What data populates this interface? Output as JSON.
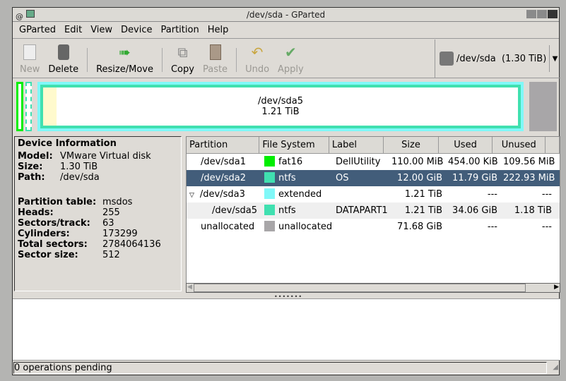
{
  "window": {
    "title": "/dev/sda - GParted"
  },
  "menu": [
    "GParted",
    "Edit",
    "View",
    "Device",
    "Partition",
    "Help"
  ],
  "toolbar": {
    "new": "New",
    "delete": "Delete",
    "resize_move": "Resize/Move",
    "copy": "Copy",
    "paste": "Paste",
    "undo": "Undo",
    "apply": "Apply"
  },
  "device_selector": {
    "device": "/dev/sda",
    "size": "(1.30 TiB)"
  },
  "disk_map": {
    "selected_partition": "/dev/sda5",
    "selected_size": "1.21 TiB",
    "colors": {
      "fat16": "#00ee00",
      "ntfs": "#40e0b0",
      "extended": "#80f8f8",
      "unallocated": "#a8a6a8"
    }
  },
  "device_info": {
    "title": "Device Information",
    "model_label": "Model:",
    "model": "VMware Virtual disk",
    "size_label": "Size:",
    "size": "1.30 TiB",
    "path_label": "Path:",
    "path": "/dev/sda",
    "partition_table_label": "Partition table:",
    "partition_table": "msdos",
    "heads_label": "Heads:",
    "heads": "255",
    "sectors_track_label": "Sectors/track:",
    "sectors_track": "63",
    "cylinders_label": "Cylinders:",
    "cylinders": "173299",
    "total_sectors_label": "Total sectors:",
    "total_sectors": "2784064136",
    "sector_size_label": "Sector size:",
    "sector_size": "512"
  },
  "table": {
    "headers": [
      "Partition",
      "File System",
      "Label",
      "Size",
      "Used",
      "Unused"
    ],
    "rows": [
      {
        "partition": "/dev/sda1",
        "fs": "fat16",
        "color": "#00ee00",
        "label": "DellUtility",
        "size": "110.00 MiB",
        "used": "454.00 KiB",
        "unused": "109.56 MiB"
      },
      {
        "partition": "/dev/sda2",
        "fs": "ntfs",
        "color": "#40e0b0",
        "label": "OS",
        "size": "12.00 GiB",
        "used": "11.79 GiB",
        "unused": "222.93 MiB"
      },
      {
        "partition": "/dev/sda3",
        "fs": "extended",
        "color": "#80f8f8",
        "label": "",
        "size": "1.21 TiB",
        "used": "---",
        "unused": "---"
      },
      {
        "partition": "/dev/sda5",
        "fs": "ntfs",
        "color": "#40e0b0",
        "label": "DATAPART1",
        "size": "1.21 TiB",
        "used": "34.06 GiB",
        "unused": "1.18 TiB"
      },
      {
        "partition": "unallocated",
        "fs": "unallocated",
        "color": "#a8a6a8",
        "label": "",
        "size": "71.68 GiB",
        "used": "---",
        "unused": "---"
      }
    ]
  },
  "status": "0 operations pending"
}
